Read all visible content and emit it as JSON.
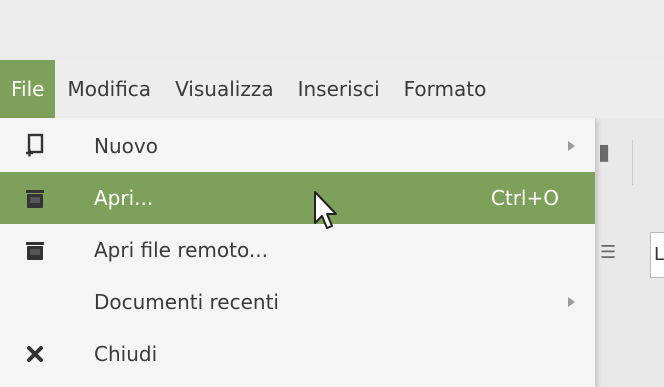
{
  "menubar": {
    "items": [
      {
        "label": "File"
      },
      {
        "label": "Modifica"
      },
      {
        "label": "Visualizza"
      },
      {
        "label": "Inserisci"
      },
      {
        "label": "Formato"
      }
    ]
  },
  "file_menu": {
    "items": [
      {
        "label": "Nuovo",
        "icon": "new-document-icon",
        "has_submenu": true
      },
      {
        "label": "Apri...",
        "icon": "open-icon",
        "shortcut": "Ctrl+O",
        "highlighted": true
      },
      {
        "label": "Apri file remoto...",
        "icon": "open-remote-icon"
      },
      {
        "label": "Documenti recenti",
        "has_submenu": true
      },
      {
        "label": "Chiudi",
        "icon": "close-icon"
      }
    ]
  },
  "toolbar": {
    "partial_box_text": "L"
  },
  "colors": {
    "accent": "#7da05a",
    "menu_bg": "#f5f5f5",
    "window_bg": "#ededed"
  }
}
